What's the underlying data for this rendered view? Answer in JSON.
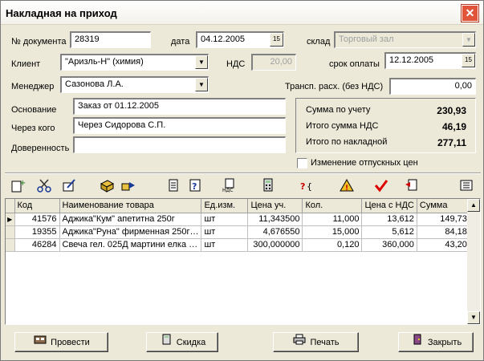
{
  "window": {
    "title": "Накладная на приход",
    "close": "✕"
  },
  "form": {
    "doc_number_label": "№ документа",
    "doc_number": "28319",
    "date_label": "дата",
    "date": "04.12.2005",
    "warehouse_label": "склад",
    "warehouse": "Торговый зал",
    "client_label": "Клиент",
    "client": "\"Аризль-Н\" (химия)",
    "vat_label": "НДС",
    "vat": "20,00",
    "due_label": "срок оплаты",
    "due_date": "12.12.2005",
    "manager_label": "Менеджер",
    "manager": "Сазонова Л.А.",
    "transport_label": "Трансп. расх. (без НДС)",
    "transport": "0,00",
    "basis_label": "Основание",
    "basis": "Заказ от 01.12.2005",
    "via_label": "Через кого",
    "via": "Через Сидорова С.П.",
    "proxy_label": "Доверенность",
    "proxy": ""
  },
  "summary": {
    "acc_label": "Сумма по учету",
    "acc": "230,93",
    "vat_label": "Итого сумма НДС",
    "vat": "46,19",
    "total_label": "Итого по накладной",
    "total": "277,11"
  },
  "price_change_label": "Изменение отпускных цен",
  "toolbar_icons": [
    "add-icon",
    "cut-icon",
    "edit-icon",
    "box-icon",
    "transfer-icon",
    "document-icon",
    "report-icon",
    "vat-doc-icon",
    "calculator-icon",
    "find-icon",
    "warning-icon",
    "check-icon",
    "import-icon",
    "list-icon"
  ],
  "grid": {
    "columns": [
      "Код",
      "Наименование товара",
      "Ед.изм.",
      "Цена уч.",
      "Кол.",
      "Цена с НДС",
      "Сумма"
    ],
    "rows": [
      [
        "41576",
        "Аджика\"Кум\" апетитна 250г",
        "шт",
        "11,343500",
        "11,000",
        "13,612",
        "149,73"
      ],
      [
        "19355",
        "Аджика\"Руна\" фирменная 250г…",
        "шт",
        "4,676550",
        "15,000",
        "5,612",
        "84,18"
      ],
      [
        "46284",
        "Свеча гел. 025Д мартини елка …",
        "шт",
        "300,000000",
        "0,120",
        "360,000",
        "43,20"
      ]
    ]
  },
  "buttons": {
    "post": "Провести",
    "discount": "Скидка",
    "print": "Печать",
    "close": "Закрыть"
  },
  "colors": {
    "accent_red": "#e0553a",
    "window_bg": "#ECE9D8"
  }
}
